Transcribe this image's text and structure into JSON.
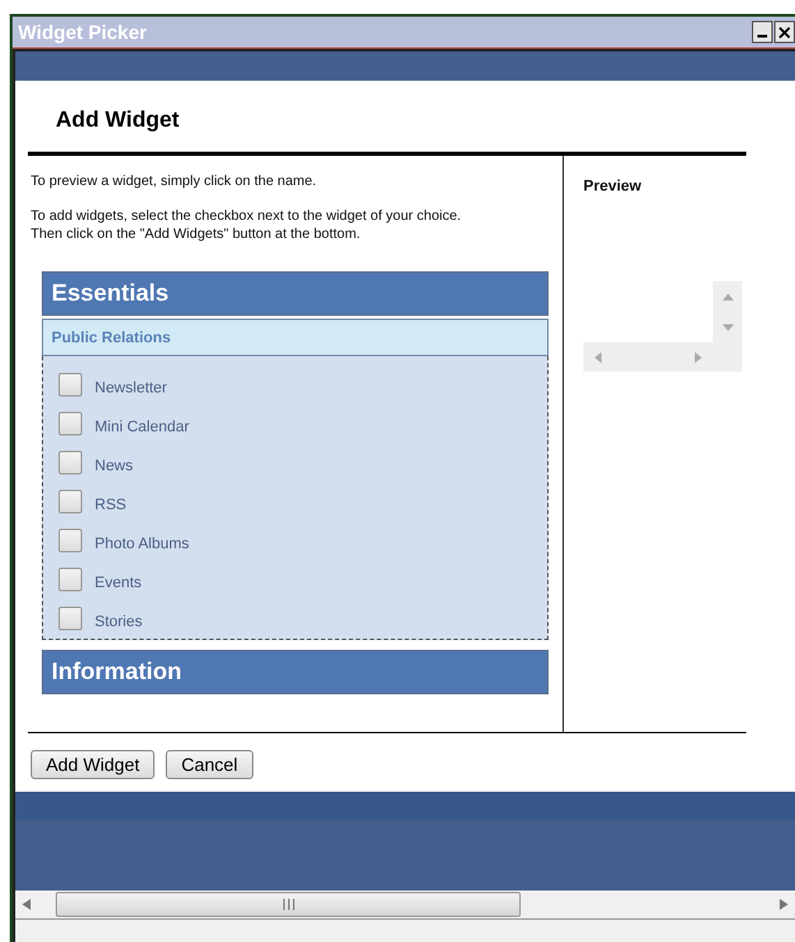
{
  "window": {
    "title": "Widget Picker"
  },
  "heading": "Add Widget",
  "instructions": [
    "To preview a widget, simply click on the name.",
    "To add widgets, select the checkbox next to the widget of your choice.\nThen click on the \"Add Widgets\" button at the bottom."
  ],
  "categories": [
    {
      "title": "Essentials",
      "groups": [
        {
          "title": "Public Relations",
          "widgets": [
            {
              "name": "Newsletter",
              "checked": false
            },
            {
              "name": "Mini Calendar",
              "checked": false
            },
            {
              "name": "News",
              "checked": false
            },
            {
              "name": "RSS",
              "checked": false
            },
            {
              "name": "Photo Albums",
              "checked": false
            },
            {
              "name": "Events",
              "checked": false
            },
            {
              "name": "Stories",
              "checked": false
            }
          ]
        }
      ]
    },
    {
      "title": "Information"
    }
  ],
  "preview": {
    "title": "Preview"
  },
  "buttons": [
    "Add Widget",
    "Cancel"
  ]
}
